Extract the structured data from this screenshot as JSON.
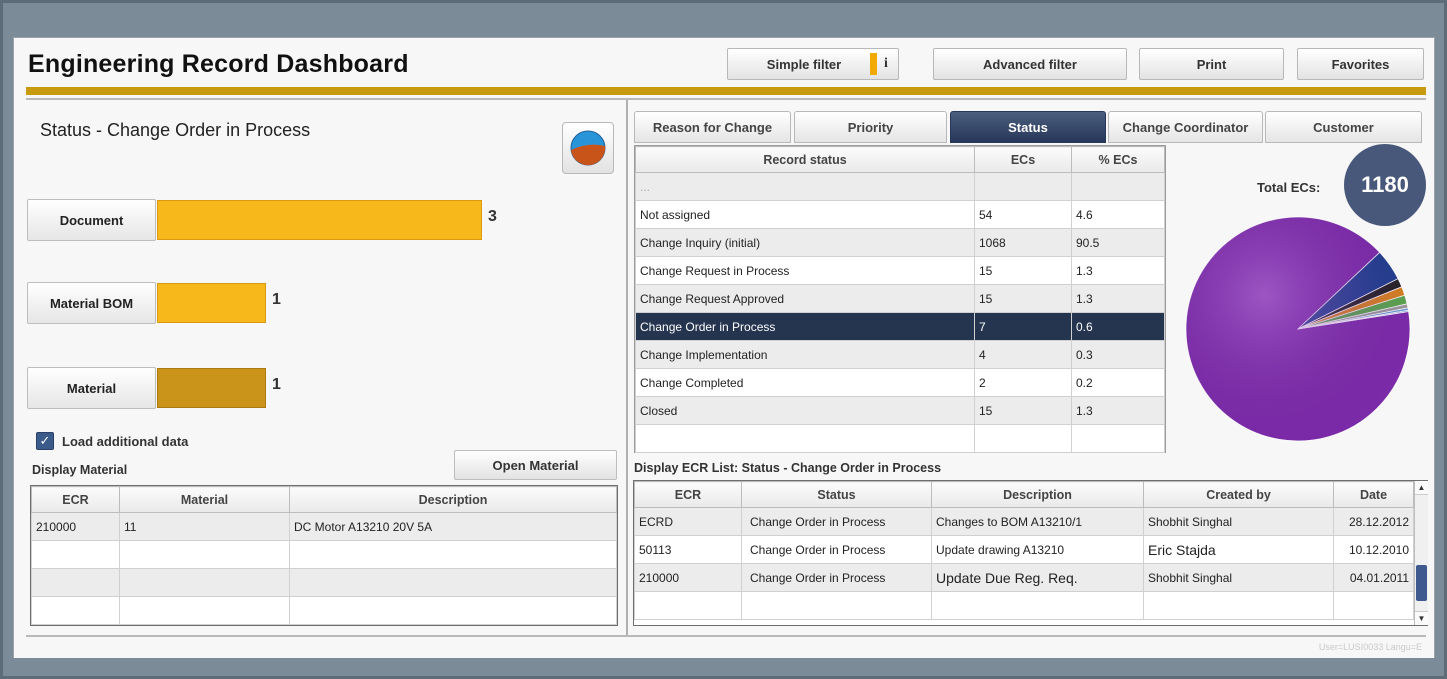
{
  "header": {
    "title": "Engineering Record Dashboard",
    "buttons": {
      "simple_filter": "Simple filter",
      "simple_filter_info": "i",
      "advanced_filter": "Advanced filter",
      "print": "Print",
      "favorites": "Favorites"
    }
  },
  "left": {
    "heading": "Status - Change Order in Process",
    "chart_icon": "pie-chart-icon",
    "categories": [
      {
        "label": "Document",
        "value": "3",
        "color": "#f7b81c"
      },
      {
        "label": "Material BOM",
        "value": "1",
        "color": "#f7b81c"
      },
      {
        "label": "Material",
        "value": "1",
        "color": "#c99419"
      }
    ],
    "load_additional": "Load additional data",
    "display_material": "Display Material",
    "open_material": "Open Material",
    "material_table": {
      "columns": [
        "ECR",
        "Material",
        "Description"
      ],
      "rows": [
        [
          "210000",
          "11",
          "DC Motor A13210 20V 5A"
        ]
      ]
    }
  },
  "tabs": [
    "Reason for Change",
    "Priority",
    "Status",
    "Change Coordinator",
    "Customer"
  ],
  "active_tab": "Status",
  "status_table": {
    "columns": [
      "Record status",
      "ECs",
      "% ECs"
    ],
    "placeholder_row": "...",
    "rows": [
      [
        "Not assigned",
        "54",
        "4.6"
      ],
      [
        "Change Inquiry (initial)",
        "1068",
        "90.5"
      ],
      [
        "Change Request in Process",
        "15",
        "1.3"
      ],
      [
        "Change Request Approved",
        "15",
        "1.3"
      ],
      [
        "Change Order in Process",
        "7",
        "0.6"
      ],
      [
        "Change Implementation",
        "4",
        "0.3"
      ],
      [
        "Change Completed",
        "2",
        "0.2"
      ],
      [
        "Closed",
        "15",
        "1.3"
      ]
    ]
  },
  "total": {
    "label": "Total ECs:",
    "value": "1180"
  },
  "pie_colors": [
    "#7b2aa8",
    "#2c6cc1",
    "#1c3f8c",
    "#222222",
    "#d9831c",
    "#59a84a",
    "#9c9c9c",
    "#5f9ad1"
  ],
  "ecr_list": {
    "heading": "Display ECR List: Status - Change Order in Process",
    "columns": [
      "ECR",
      "Status",
      "Description",
      "Created by",
      "Date"
    ],
    "rows": [
      [
        "ECRD",
        "Change Order in Process",
        "Changes to BOM A13210/1",
        "Shobhit Singhal",
        "28.12.2012"
      ],
      [
        "50113",
        "Change Order in Process",
        "Update drawing A13210",
        "Eric Stajda",
        "10.12.2010"
      ],
      [
        "210000",
        "Change Order in Process",
        "Update Due Reg. Req.",
        "Shobhit Singhal",
        "04.01.2011"
      ]
    ]
  },
  "footer": "User=LUSI0033  Langu=E"
}
